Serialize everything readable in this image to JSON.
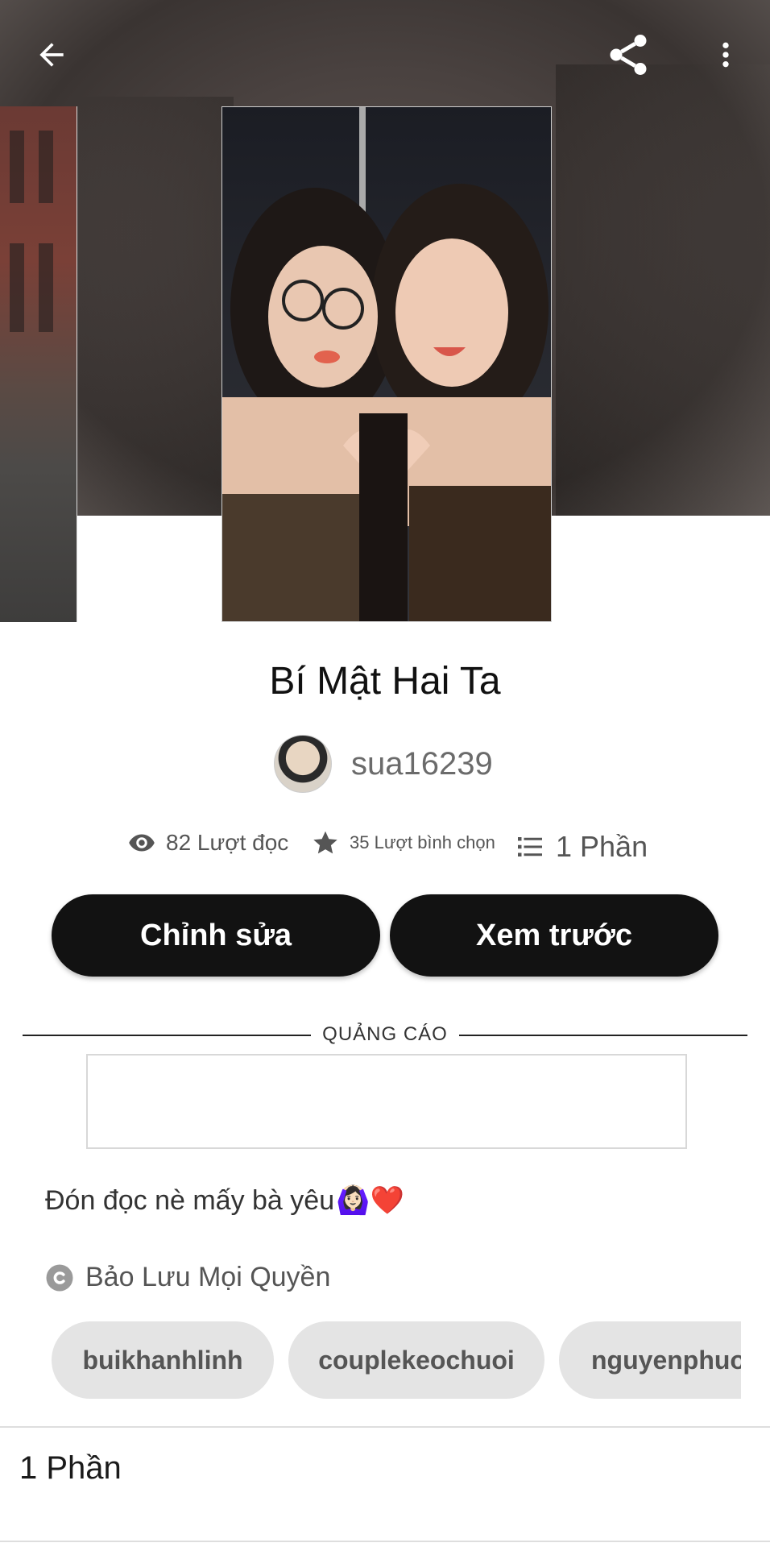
{
  "story": {
    "title": "Bí Mật Hai Ta",
    "author": "sua16239",
    "description": "Đón đọc nè mấy bà yêu",
    "description_emojis": "🙆🏻‍♀️❤️",
    "copyright": "Bảo Lưu Mọi Quyền"
  },
  "stats": {
    "reads": "82 Lượt đọc",
    "votes": "35 Lượt bình chọn",
    "parts": "1 Phần"
  },
  "actions": {
    "edit_label": "Chỉnh sửa",
    "preview_label": "Xem trước"
  },
  "ad": {
    "label": "QUẢNG CÁO"
  },
  "tags": [
    "buikhanhlinh",
    "couplekeochuoi",
    "nguyenphuo"
  ],
  "toc": {
    "parts_label": "1 Phần"
  },
  "icons": {
    "back": "arrow-left-icon",
    "share": "share-icon",
    "more": "more-vertical-icon",
    "reads": "eye-icon",
    "votes": "star-icon",
    "parts": "list-icon",
    "copyright": "copyright-icon"
  }
}
